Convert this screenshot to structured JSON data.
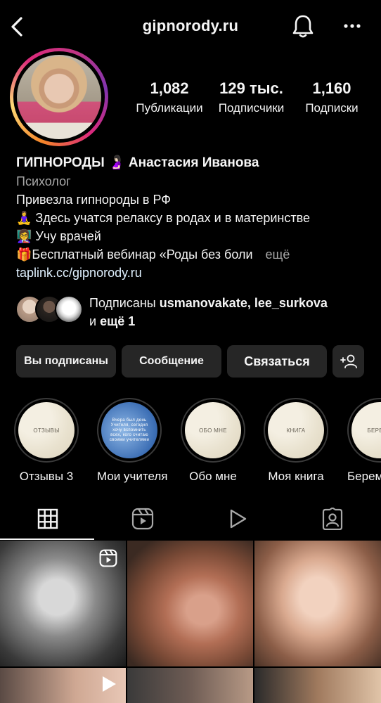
{
  "header": {
    "title": "gipnorody.ru",
    "icons": [
      "chevron-left-icon",
      "bell-icon",
      "more-icon"
    ]
  },
  "stats": [
    {
      "value": "1,082",
      "label": "Публикации"
    },
    {
      "value": "129 тыс.",
      "label": "Подписчики"
    },
    {
      "value": "1,160",
      "label": "Подписки"
    }
  ],
  "bio": {
    "name": "ГИПНОРОДЫ 🤰🏻 Анастасия Иванова",
    "category": "Психолог",
    "line1": "Привезла гипнороды в РФ",
    "line2": "🧘‍♀️ Здесь учатся релаксу в родах и в материнстве",
    "line3": "👩‍🏫  Учу врачей",
    "line4": "🎁Бесплатный вебинар «Роды без боли",
    "more": "ещё",
    "link": "taplink.cc/gipnorody.ru"
  },
  "mutual": {
    "prefix": "Подписаны",
    "names": "usmanovakate, lee_surkova",
    "and": "и",
    "more": "ещё 1"
  },
  "buttons": {
    "following": "Вы подписаны",
    "message": "Сообщение",
    "contact": "Связаться"
  },
  "highlights": [
    {
      "label": "Отзывы 3",
      "cover": "отзывы"
    },
    {
      "label": "Мои учителя",
      "cover": "Вчера был день Учителя, сегодня хочу вспомнить всех, кого считаю своими учителями"
    },
    {
      "label": "Обо мне",
      "cover": "обо мне"
    },
    {
      "label": "Моя книга",
      "cover": "книга"
    },
    {
      "label": "Береме",
      "cover": "береме"
    }
  ],
  "colors": {
    "background": "#000000",
    "button": "#262626",
    "secondary_text": "#a8a8a8",
    "link": "#e0f1ff"
  }
}
